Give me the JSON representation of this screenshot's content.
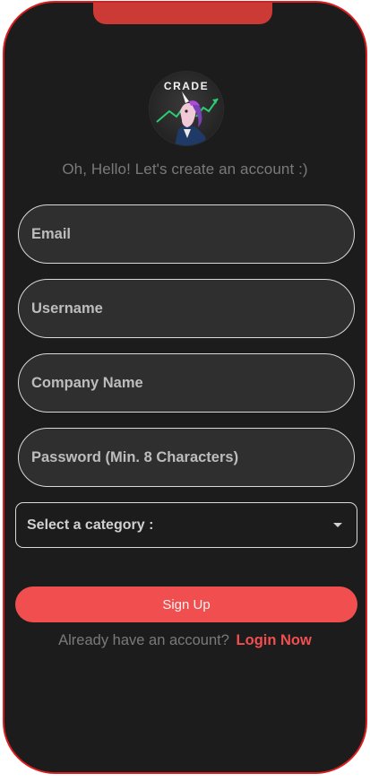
{
  "logo": {
    "wordmark": "CRADE"
  },
  "greeting": "Oh, Hello! Let's create an account :)",
  "form": {
    "email_placeholder": "Email",
    "username_placeholder": "Username",
    "company_placeholder": "Company Name",
    "password_placeholder": "Password (Min. 8 Characters)",
    "category_label": "Select a category :"
  },
  "signup_label": "Sign Up",
  "login": {
    "prompt": "Already have an account?",
    "link": "Login Now"
  },
  "colors": {
    "frame": "#d81e1e",
    "notch": "#cc3a36",
    "background": "#1c1c1c",
    "field_fill": "#2f2f2f",
    "field_border": "#d9d9d9",
    "accent": "#f14f4f",
    "muted_text": "#7a7a7a"
  },
  "icons": {
    "logo": "unicorn-chart-logo",
    "dropdown": "caret-down-icon"
  }
}
